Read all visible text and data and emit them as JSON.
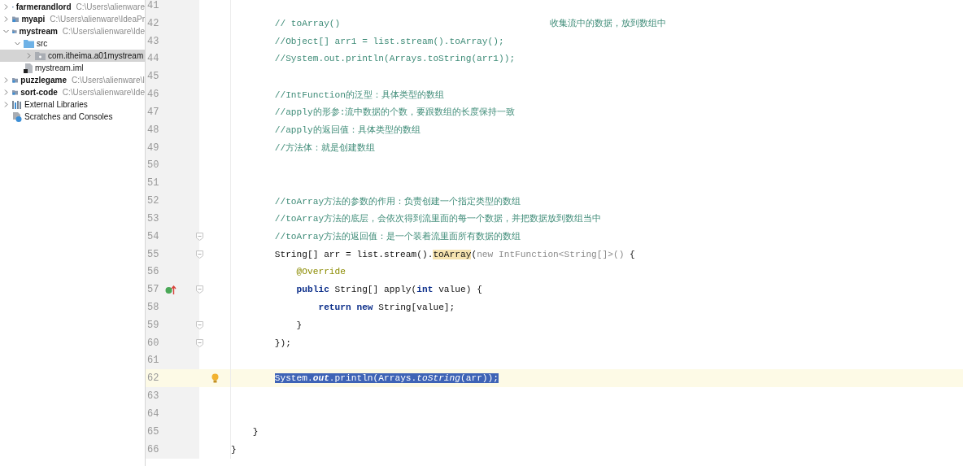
{
  "project_tree": [
    {
      "label": "farmerandlord",
      "path": "C:\\Users\\alienware",
      "kind": "module",
      "expanded": false,
      "selected": false
    },
    {
      "label": "myapi",
      "path": "C:\\Users\\alienware\\IdeaPr",
      "kind": "module",
      "expanded": false,
      "selected": false
    },
    {
      "label": "mystream",
      "path": "C:\\Users\\alienware\\Ide",
      "kind": "module",
      "expanded": true,
      "selected": false,
      "children": [
        {
          "label": "src",
          "kind": "folder",
          "expanded": true,
          "selected": false,
          "children": [
            {
              "label": "com.itheima.a01mystream",
              "kind": "package",
              "expanded": false,
              "selected": true
            }
          ]
        },
        {
          "label": "mystream.iml",
          "kind": "file",
          "selected": false
        }
      ]
    },
    {
      "label": "puzzlegame",
      "path": "C:\\Users\\alienware\\I",
      "kind": "module",
      "expanded": false,
      "selected": false
    },
    {
      "label": "sort-code",
      "path": "C:\\Users\\alienware\\Ide",
      "kind": "module",
      "expanded": false,
      "selected": false
    },
    {
      "label": "External Libraries",
      "kind": "libraries",
      "expanded": false,
      "selected": false
    },
    {
      "label": "Scratches and Consoles",
      "kind": "scratches",
      "selected": false
    }
  ],
  "editor": {
    "lines": [
      {
        "number": "41"
      },
      {
        "number": "42",
        "segments": [
          {
            "text": "        // toArray()",
            "kind": "comment"
          }
        ],
        "end_comment": "收集流中的数据，放到数组中"
      },
      {
        "number": "43",
        "segments": [
          {
            "text": "        //Object[] arr1 = list.stream().toArray();",
            "kind": "comment"
          }
        ]
      },
      {
        "number": "44",
        "segments": [
          {
            "text": "        //System.out.println(Arrays.toString(arr1));",
            "kind": "comment"
          }
        ]
      },
      {
        "number": "45"
      },
      {
        "number": "46",
        "segments": [
          {
            "text": "        //IntFunction的泛型：具体类型的数组",
            "kind": "comment"
          }
        ]
      },
      {
        "number": "47",
        "segments": [
          {
            "text": "        //apply的形参:流中数据的个数，要跟数组的长度保持一致",
            "kind": "comment"
          }
        ]
      },
      {
        "number": "48",
        "segments": [
          {
            "text": "        //apply的返回值：具体类型的数组",
            "kind": "comment"
          }
        ]
      },
      {
        "number": "49",
        "segments": [
          {
            "text": "        //方法体：就是创建数组",
            "kind": "comment"
          }
        ]
      },
      {
        "number": "50"
      },
      {
        "number": "51"
      },
      {
        "number": "52",
        "segments": [
          {
            "text": "        //toArray方法的参数的作用：负责创建一个指定类型的数组",
            "kind": "comment"
          }
        ]
      },
      {
        "number": "53",
        "segments": [
          {
            "text": "        //toArray方法的底层，会依次得到流里面的每一个数据，并把数据放到数组当中",
            "kind": "comment"
          }
        ]
      },
      {
        "number": "54",
        "fold": true,
        "segments": [
          {
            "text": "        //toArray方法的返回值：是一个装着流里面所有数据的数组",
            "kind": "comment"
          }
        ]
      },
      {
        "number": "55",
        "fold": true,
        "segments": [
          {
            "text": "        String[] arr = list.stream().",
            "kind": "plain"
          },
          {
            "text": "toArray",
            "kind": "usage"
          },
          {
            "text": "(",
            "kind": "plain"
          },
          {
            "text": "new IntFunction<String[]>()",
            "kind": "faded"
          },
          {
            "text": " {",
            "kind": "plain"
          }
        ]
      },
      {
        "number": "56",
        "segments": [
          {
            "text": "            @Override",
            "kind": "annotation"
          }
        ]
      },
      {
        "number": "57",
        "fold": true,
        "gutter_icon": {
          "kind": "override"
        },
        "segments": [
          {
            "text": "            public",
            "kind": "keyword"
          },
          {
            "text": " String[] apply(",
            "kind": "plain"
          },
          {
            "text": "int",
            "kind": "keyword"
          },
          {
            "text": " value) {",
            "kind": "plain"
          }
        ]
      },
      {
        "number": "58",
        "segments": [
          {
            "text": "                return new",
            "kind": "keyword"
          },
          {
            "text": " String[value];",
            "kind": "plain"
          }
        ]
      },
      {
        "number": "59",
        "fold": true,
        "segments": [
          {
            "text": "            }",
            "kind": "plain"
          }
        ]
      },
      {
        "number": "60",
        "fold": true,
        "segments": [
          {
            "text": "        });",
            "kind": "plain"
          }
        ]
      },
      {
        "number": "61"
      },
      {
        "number": "62",
        "current": true,
        "gutter_icon": {
          "kind": "bulb"
        },
        "selected": true,
        "kind": "indented",
        "segments": [
          {
            "text": "System.",
            "kind": "plain"
          },
          {
            "text": "out",
            "kind": "static"
          },
          {
            "text": ".println(Arrays.",
            "kind": "plain"
          },
          {
            "text": "toString",
            "kind": "italic"
          },
          {
            "text": "(arr));",
            "kind": "plain"
          }
        ]
      },
      {
        "number": "63"
      },
      {
        "number": "64"
      },
      {
        "number": "65",
        "segments": [
          {
            "text": "    }",
            "kind": "plain"
          }
        ]
      },
      {
        "number": "66",
        "segments": [
          {
            "text": "}",
            "kind": "plain"
          }
        ]
      }
    ]
  }
}
